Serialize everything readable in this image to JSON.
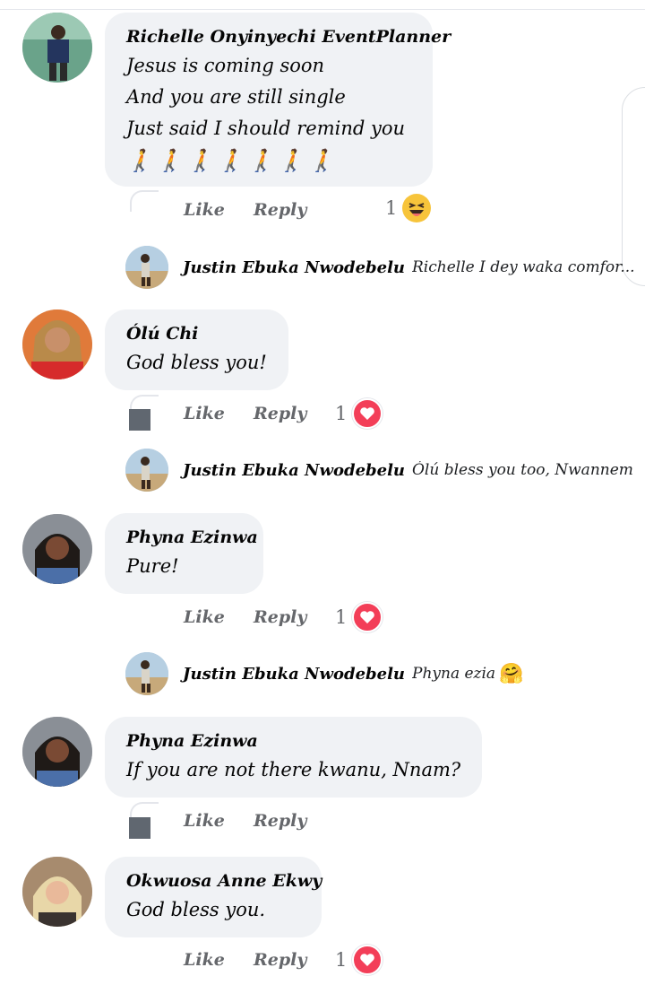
{
  "actions": {
    "like": "Like",
    "reply": "Reply"
  },
  "comments": [
    {
      "name": "Richelle Onyinyechi EventPlanner",
      "lines": [
        "Jesus is coming soon",
        "And you are still single",
        "Just said I should remind you"
      ],
      "emoji_line": "🚶🚶🚶🚶🚶🚶🚶",
      "reaction": {
        "type": "haha",
        "count": "1"
      },
      "reply": {
        "name": "Justin Ebuka Nwodebelu",
        "text": "Richelle I dey waka comfor..."
      }
    },
    {
      "name": "Ólú Chi",
      "lines": [
        "God bless you!"
      ],
      "reaction": {
        "type": "love",
        "count": "1"
      },
      "reply": {
        "name": "Justin Ebuka Nwodebelu",
        "text": "Ólú bless you too, Nwannem"
      }
    },
    {
      "name": "Phyna Ezinwa",
      "lines": [
        "Pure!"
      ],
      "reaction": {
        "type": "love",
        "count": "1"
      },
      "reply": {
        "name": "Justin Ebuka Nwodebelu",
        "text": "Phyna ezia",
        "emoji": "🤗"
      }
    },
    {
      "name": "Phyna Ezinwa",
      "lines": [
        "If you are not there kwanu, Nnam?"
      ]
    },
    {
      "name": "Okwuosa Anne Ekwy",
      "lines": [
        "God bless you."
      ],
      "reaction": {
        "type": "love",
        "count": "1"
      }
    }
  ],
  "colors": {
    "bubble": "#f0f2f5",
    "love": "#f33e58",
    "haha": "#f7c43b",
    "meta": "#65676b"
  },
  "icons": {
    "love": "heart-reaction-icon",
    "haha": "laughing-reaction-icon"
  }
}
